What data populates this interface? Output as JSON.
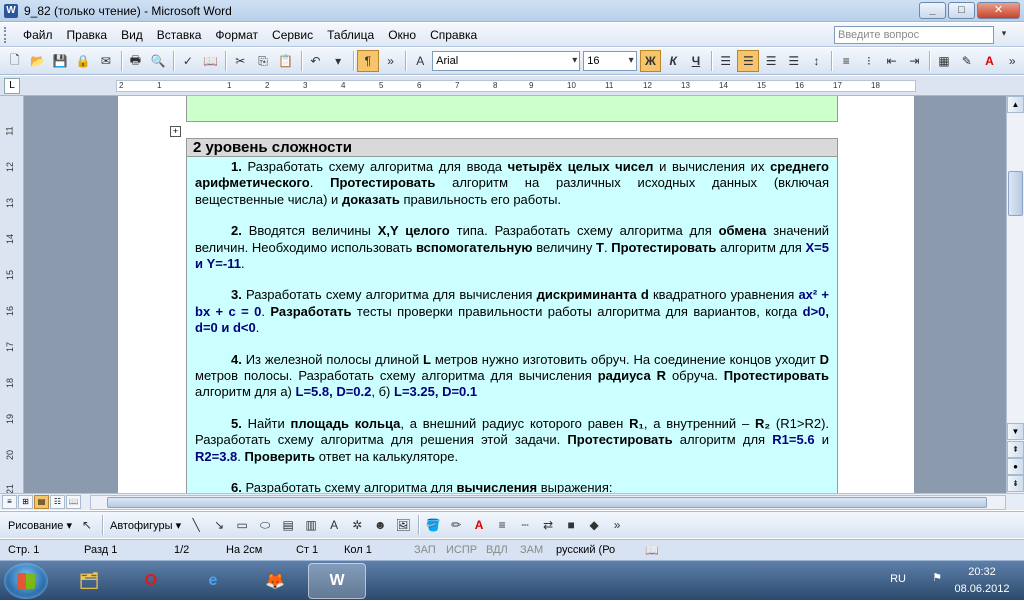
{
  "window": {
    "title": "9_82 (только чтение) - Microsoft Word",
    "buttons": [
      "_",
      "□",
      "✕"
    ]
  },
  "menu": {
    "items": [
      "Файл",
      "Правка",
      "Вид",
      "Вставка",
      "Формат",
      "Сервис",
      "Таблица",
      "Окно",
      "Справка"
    ],
    "ask_placeholder": "Введите вопрос"
  },
  "toolbar": {
    "font": "Arial",
    "size": "16",
    "bold": "Ж",
    "italic": "К",
    "underline": "Ч"
  },
  "ruler": {
    "ticks": [
      "2",
      "1",
      "1",
      "2",
      "3",
      "4",
      "5",
      "6",
      "7",
      "8",
      "9",
      "10",
      "11",
      "12",
      "13",
      "14",
      "15",
      "16",
      "17",
      "18"
    ]
  },
  "vruler": {
    "ticks": [
      "11",
      "12",
      "13",
      "14",
      "15",
      "16",
      "17",
      "18",
      "19",
      "20",
      "21"
    ]
  },
  "document": {
    "table_heading": "2 уровень сложности",
    "p1": {
      "num": "1.",
      "t1": " Разработать схему алгоритма для ввода ",
      "b1": "четырёх целых чисел",
      "t2": " и вычисления их ",
      "b2": "среднего арифметического",
      "t3": ". ",
      "b3": "Протестировать",
      "t4": " алгоритм  на различных исходных данных (включая вещественные числа) и ",
      "b4": "доказать",
      "t5": " правильность его работы."
    },
    "p2": {
      "num": "2.",
      "t1": " Вводятся величины ",
      "b1": "X,Y целого",
      "t2": " типа. Разработать схему алгоритма для ",
      "b2": "обмена",
      "t3": " значений величин. Необходимо использовать ",
      "b3": "вспомогательную",
      "t4": " величину ",
      "b4": "T",
      "t5": ". ",
      "b5": "Протестировать",
      "t6": " алгоритм для ",
      "c1": "X=5 и Y=-11",
      "t7": "."
    },
    "p3": {
      "num": "3.",
      "t1": " Разработать схему алгоритма для вычисления ",
      "b1": "дискриминанта d",
      "t2": " квадратного уравнения ",
      "c1": "ax² + bx + c = 0",
      "t3": ". ",
      "b2": "Разработать",
      "t4": " тесты проверки правильности работы алгоритма для вариантов, когда ",
      "c2": "d>0, d=0 и d<0",
      "t5": "."
    },
    "p4": {
      "num": "4.",
      "t1": " Из железной полосы длиной ",
      "b1": "L",
      "t2": " метров нужно изготовить обруч. На соединение концов уходит ",
      "b2": "D",
      "t3": " метров полосы. Разработать схему алгоритма для вычисления ",
      "b3": "радиуса R",
      "t4": " обруча. ",
      "b4": "Протестировать",
      "t5": " алгоритм для а) ",
      "c1": "L=5.8, D=0.2",
      "t6": ",  б) ",
      "c2": "L=3.25, D=0.1"
    },
    "p5": {
      "num": "5.",
      "t1": " Найти ",
      "b1": "площадь кольца",
      "t2": ", а внешний радиус которого равен ",
      "b2": "R₁",
      "t3": ", а внутренний – ",
      "b3": "R₂",
      "t4": " (R1>R2). Разработать схему алгоритма для решения этой задачи. ",
      "b4": "Протестировать",
      "t5": " алгоритм для ",
      "c1": "R1=5.6",
      "t6": " и ",
      "c2": "R2=3.8",
      "t7": ". ",
      "b5": "Проверить",
      "t8": " ответ на калькуляторе."
    },
    "p6": {
      "num": "6.",
      "t1": " Разработать схему алгоритма для ",
      "b1": "вычисления",
      "t2": " выражения:"
    }
  },
  "drawbar": {
    "draw": "Рисование ▾",
    "autoshapes": "Автофигуры ▾"
  },
  "status": {
    "page": "Стр. 1",
    "section": "Разд 1",
    "pages": "1/2",
    "at": "На 2см",
    "line": "Ст 1",
    "col": "Кол 1",
    "rec": "ЗАП",
    "trk": "ИСПР",
    "ext": "ВДЛ",
    "ovr": "ЗАМ",
    "lang": "русский (Ро"
  },
  "tray": {
    "lang": "RU",
    "time": "20:32",
    "date": "08.06.2012"
  }
}
